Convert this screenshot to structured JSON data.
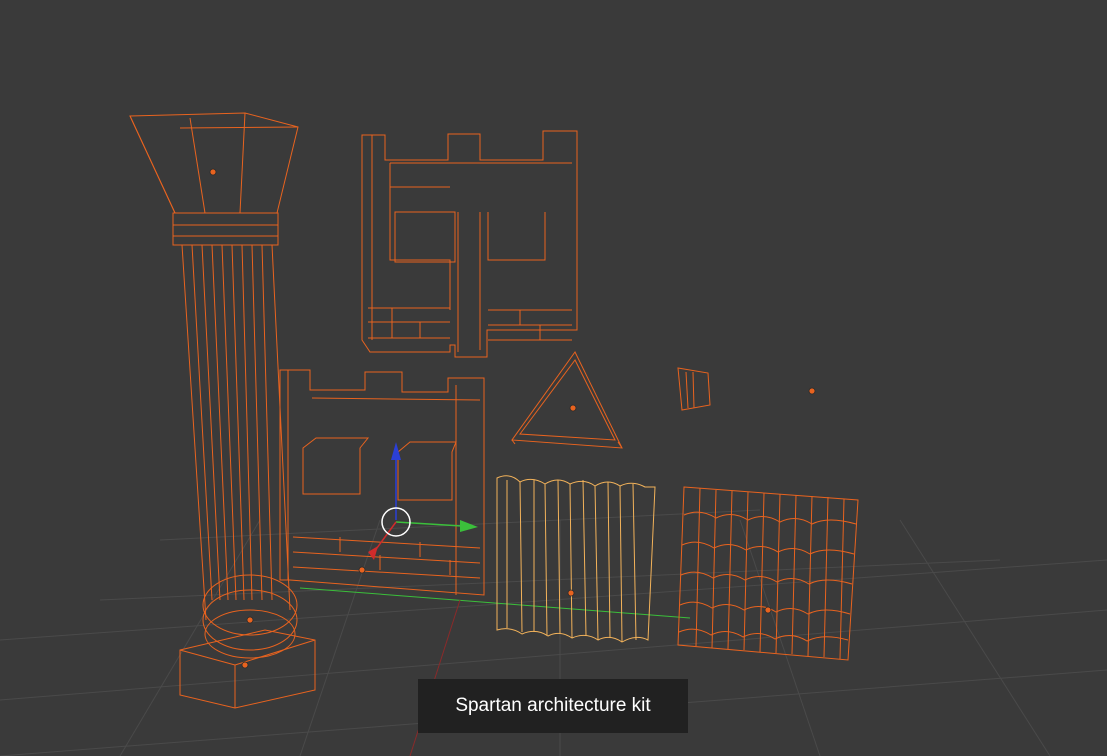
{
  "viewport": {
    "caption": "Spartan architecture kit",
    "colors": {
      "background": "#3a3a3a",
      "wireframe": "#e8631f",
      "wireframe_active": "#f2b25a",
      "grid": "#4a4a4a",
      "axis_x": "#d02b2b",
      "axis_y": "#3bbf3b",
      "axis_z": "#2b3fd6"
    },
    "icons": {
      "manipulator": "transform-gizmo-icon"
    }
  }
}
